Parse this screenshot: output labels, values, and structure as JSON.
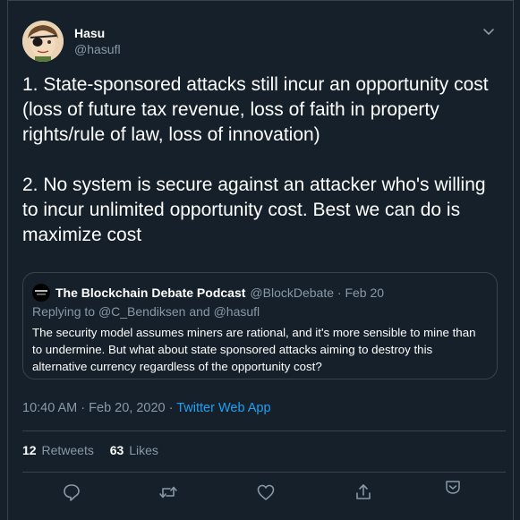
{
  "author": {
    "name": "Hasu",
    "handle": "@hasufl"
  },
  "tweet": {
    "paragraph_1": "1. State-sponsored attacks still incur an opportunity cost (loss of future tax revenue, loss of faith in property rights/rule of law, loss of innovation)",
    "paragraph_2": "2. No system is secure against an attacker who's willing to incur unlimited opportunity cost. Best we can do is maximize cost"
  },
  "quoted": {
    "name": "The Blockchain Debate Podcast",
    "handle_date": "@BlockDebate · Feb 20",
    "replying_prefix": "Replying to",
    "reply_mention_1": "@C_Bendiksen",
    "reply_and": "and",
    "reply_mention_2": "@hasufl",
    "body": "The security model assumes miners are rational, and it's more sensible to mine than to undermine. But what about state sponsored attacks aiming to destroy this alternative currency regardless of the opportunity cost?"
  },
  "meta": {
    "timestamp": "10:40 AM · Feb 20, 2020 ·",
    "source_app": "Twitter Web App"
  },
  "stats": {
    "retweets_count": "12",
    "retweets_label": "Retweets",
    "likes_count": "63",
    "likes_label": "Likes"
  },
  "actions": [
    "reply-icon",
    "retweet-icon",
    "like-icon",
    "share-icon",
    "chevron-down-icon"
  ],
  "colors": {
    "background": "#15202b",
    "border": "#38444d",
    "muted": "#8899a6",
    "accent": "#1da1f2"
  }
}
